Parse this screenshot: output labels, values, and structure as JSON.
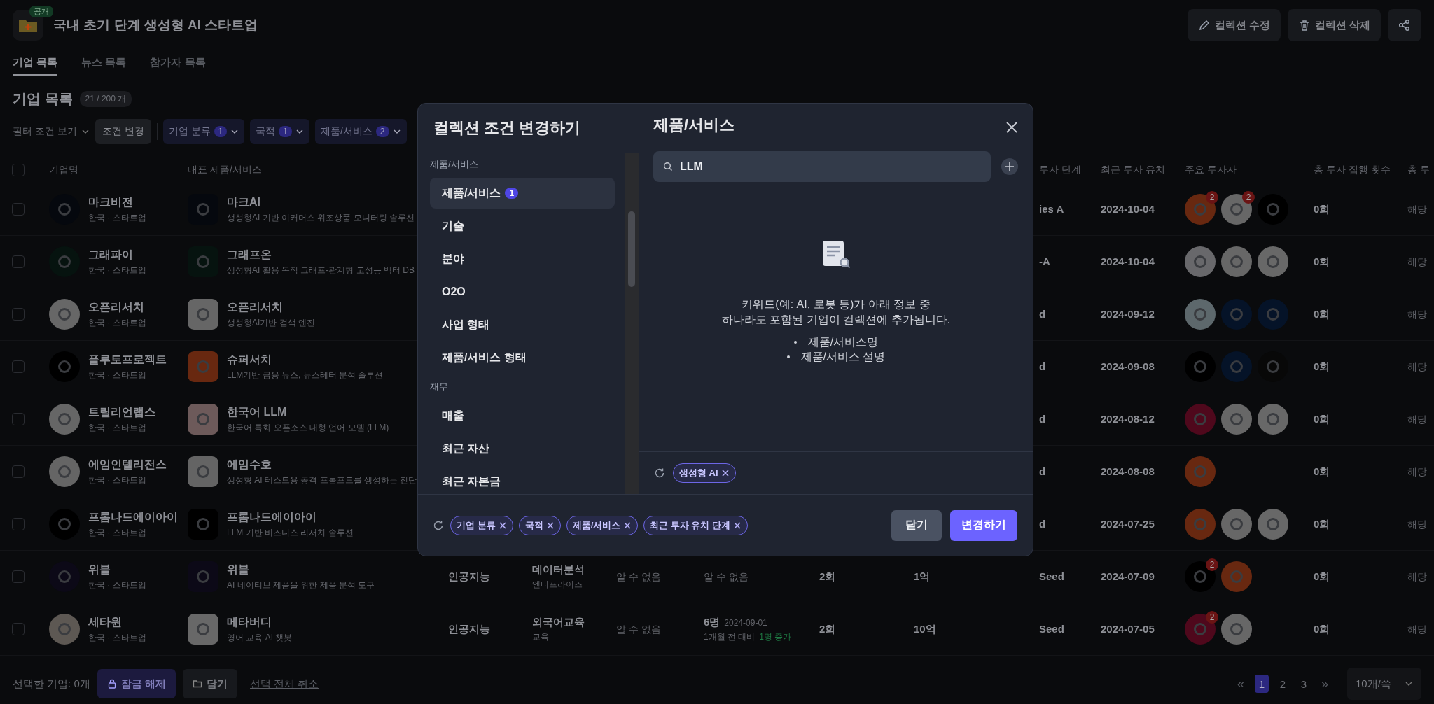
{
  "header": {
    "badge": "공개",
    "title": "국내 초기 단계 생성형 AI 스타트업",
    "actions": [
      {
        "kind": "edit",
        "label": "컬렉션 수정"
      },
      {
        "kind": "delete",
        "label": "컬렉션 삭제"
      },
      {
        "kind": "share"
      }
    ]
  },
  "tabs": [
    {
      "label": "기업 목록",
      "selected": true
    },
    {
      "label": "뉴스 목록",
      "selected": false
    },
    {
      "label": "참가자 목록",
      "selected": false
    }
  ],
  "section": {
    "title": "기업 목록",
    "count": "21 / 200 개"
  },
  "filters": {
    "toggle": "필터 조건 보기",
    "change": "조건 변경",
    "chips": [
      {
        "label": "기업 분류",
        "count": "1"
      },
      {
        "label": "국적",
        "count": "1"
      },
      {
        "label": "제품/서비스",
        "count": "2"
      }
    ]
  },
  "table": {
    "columns": [
      "기업명",
      "대표 제품/서비스",
      "투자 단계",
      "최근 투자 유치",
      "주요 투자자",
      "총 투자 집행 횟수",
      "총 투"
    ],
    "select_all": {
      "checked": false
    },
    "rows": [
      {
        "checked": false,
        "company": {
          "name": "마크비전",
          "meta": "한국 · 스타트업",
          "color": "#05080e"
        },
        "product": {
          "name": "마크AI",
          "desc": "생성형AI 기반 이커머스 위조상품 모니터링 솔루션",
          "color": "#05080e"
        },
        "stage": "ies A",
        "date": "2024-10-04",
        "investors": [
          {
            "color": "#682810",
            "badge": "2"
          },
          {
            "color": "#676767",
            "badge": "2"
          },
          {
            "color": "#000000"
          }
        ],
        "count": "0회",
        "column_14": "해당"
      },
      {
        "checked": false,
        "company": {
          "name": "그래파이",
          "meta": "한국 · 스타트업",
          "color": "#06130f"
        },
        "product": {
          "name": "그래프온",
          "desc": "생성형AI 활용 목적 그래프-관계형 고성능 벡터 DB",
          "color": "#06130f"
        },
        "stage": "-A",
        "date": "2024-10-04",
        "investors": [
          {
            "color": "#68686b"
          },
          {
            "color": "#676767"
          },
          {
            "color": "#686868"
          }
        ],
        "count": "0회",
        "column_14": "해당"
      },
      {
        "checked": false,
        "company": {
          "name": "오픈리서치",
          "meta": "한국 · 스타트업",
          "color": "#676767"
        },
        "product": {
          "name": "오픈리서치",
          "desc": "생성형AI기반 검색 엔진",
          "color": "#666666"
        },
        "stage": "d",
        "date": "2024-09-12",
        "investors": [
          {
            "color": "#5d686c"
          },
          {
            "color": "#051328"
          },
          {
            "color": "#051328"
          }
        ],
        "count": "0회",
        "column_14": "해당"
      },
      {
        "checked": false,
        "company": {
          "name": "플루토프로젝트",
          "meta": "한국 · 스타트업",
          "color": "#000000"
        },
        "product": {
          "name": "슈퍼서치",
          "desc": "LLM기반 금융 뉴스, 뉴스레터 분석 솔루션",
          "color": "#682810"
        },
        "stage": "d",
        "date": "2024-09-08",
        "investors": [
          {
            "color": "#000000"
          },
          {
            "color": "#051328"
          },
          {
            "color": "#080808"
          }
        ],
        "count": "0회",
        "column_14": "해당"
      },
      {
        "checked": false,
        "company": {
          "name": "트릴리언랩스",
          "meta": "한국 · 스타트업",
          "color": "#666666"
        },
        "product": {
          "name": "한국어 LLM",
          "desc": "한국어 특화 오픈소스 대형 언어 모델 (LLM)",
          "color": "#6d5a5a"
        },
        "stage": "d",
        "date": "2024-08-12",
        "investors": [
          {
            "color": "#4f081c"
          },
          {
            "color": "#676767"
          },
          {
            "color": "#686868"
          }
        ],
        "count": "0회",
        "column_14": "해당"
      },
      {
        "checked": false,
        "company": {
          "name": "에임인텔리전스",
          "meta": "한국 · 스타트업",
          "color": "#656565"
        },
        "product": {
          "name": "에임수호",
          "desc": "생성형 AI 테스트용 공격 프롬프트를 생성하는 진단",
          "color": "#646464"
        },
        "stage": "d",
        "date": "2024-08-08",
        "investors": [
          {
            "color": "#682810"
          }
        ],
        "count": "0회",
        "column_14": "해당"
      },
      {
        "checked": false,
        "company": {
          "name": "프롬나드에이아이",
          "meta": "한국 · 스타트업",
          "color": "#000000"
        },
        "product": {
          "name": "프롬나드에이아이",
          "desc": "LLM 기반 비즈니스 리서치 솔루션",
          "color": "#000000"
        },
        "stage": "d",
        "date": "2024-07-25",
        "investors": [
          {
            "color": "#682810"
          },
          {
            "color": "#676767"
          },
          {
            "color": "#686868"
          }
        ],
        "count": "0회",
        "column_14": "해당"
      },
      {
        "checked": false,
        "company": {
          "name": "위블",
          "meta": "한국 · 스타트업",
          "color": "#0c0917"
        },
        "product": {
          "name": "위블",
          "desc": "AI 네이티브 제품을 위한 제품 분석 도구",
          "color": "#0c0917"
        },
        "details": {
          "column_4": "인공지능",
          "column_5": "데이터분석",
          "column_5_sub": "엔터프라이즈",
          "column_6": "알 수 없음",
          "column_7": {
            "kind": "text",
            "value": "알 수 없음"
          },
          "column_8": "2회",
          "column_9": "1억"
        },
        "stage": "Seed",
        "date": "2024-07-09",
        "investors": [
          {
            "color": "#000000",
            "badge": "2"
          },
          {
            "color": "#682810"
          }
        ],
        "count": "0회",
        "column_14": "해당"
      },
      {
        "checked": false,
        "company": {
          "name": "세타원",
          "meta": "한국 · 스타트업",
          "color": "#5d5853"
        },
        "product": {
          "name": "메타버디",
          "desc": "영어 교육 AI 챗봇",
          "color": "#686868"
        },
        "details": {
          "column_4": "인공지능",
          "column_5": "외국어교육",
          "column_5_sub": "교육",
          "column_6": "알 수 없음",
          "column_7": {
            "kind": "growth",
            "value": "6명",
            "date": "2024-09-01",
            "change_label": "1개월 전 대비",
            "change_value": "1명 증가"
          },
          "column_8": "2회",
          "column_9": "10억"
        },
        "stage": "Seed",
        "date": "2024-07-05",
        "investors": [
          {
            "color": "#4f081c",
            "badge": "2"
          },
          {
            "color": "#676767"
          }
        ],
        "count": "0회",
        "column_14": "해당"
      }
    ]
  },
  "footer": {
    "selected": "선택한 기업: 0개",
    "unlock": "잠금 해제",
    "save": "담기",
    "clear": "선택 전체 취소",
    "first": "«",
    "pages": [
      {
        "label": "1",
        "selected": true
      },
      {
        "label": "2",
        "selected": false
      },
      {
        "label": "3",
        "selected": false
      }
    ],
    "last": "»",
    "page_size": "10개/쪽"
  },
  "modal": {
    "title": "컬렉션 조건 변경하기",
    "groups": [
      {
        "label": "제품/서비스",
        "items": [
          {
            "label": "제품/서비스",
            "count": "1",
            "selected": true
          },
          {
            "label": "기술",
            "selected": false
          },
          {
            "label": "분야",
            "selected": false
          },
          {
            "label": "O2O",
            "selected": false
          },
          {
            "label": "사업 형태",
            "selected": false
          },
          {
            "label": "제품/서비스 형태",
            "selected": false
          }
        ]
      },
      {
        "label": "재무",
        "items": [
          {
            "label": "매출",
            "selected": false
          },
          {
            "label": "최근 자산",
            "selected": false
          },
          {
            "label": "최근 자본금",
            "selected": false
          }
        ]
      }
    ],
    "panel_title": "제품/서비스",
    "search": {
      "value": "LLM"
    },
    "hint": [
      "키워드(예: AI, 로봇 등)가 아래 정보 중",
      "하나라도 포함된 기업이 컬렉션에 추가됩니다."
    ],
    "fields": [
      "제품/서비스명",
      "제품/서비스 설명"
    ],
    "keywords": [
      "생성형 AI"
    ],
    "conditions": [
      "기업 분류",
      "국적",
      "제품/서비스",
      "최근 투자 유치 단계"
    ],
    "close": "닫기",
    "submit": "변경하기"
  }
}
